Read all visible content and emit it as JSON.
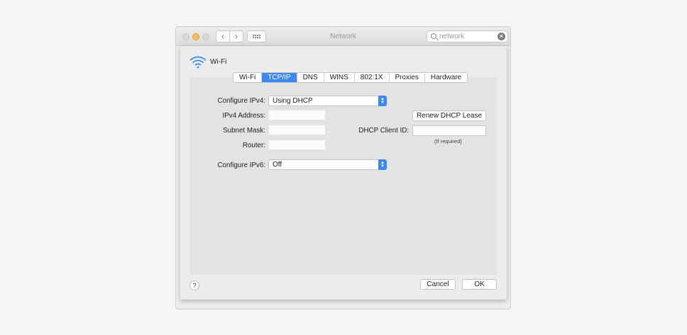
{
  "window": {
    "title": "Network"
  },
  "search": {
    "placeholder": "network"
  },
  "interface": {
    "name": "Wi-Fi"
  },
  "tabs": [
    "Wi-Fi",
    "TCP/IP",
    "DNS",
    "WINS",
    "802.1X",
    "Proxies",
    "Hardware"
  ],
  "active_tab": "TCP/IP",
  "form": {
    "configure_ipv4_label": "Configure IPv4:",
    "configure_ipv4_value": "Using DHCP",
    "ipv4_address_label": "IPv4 Address:",
    "subnet_mask_label": "Subnet Mask:",
    "router_label": "Router:",
    "configure_ipv6_label": "Configure IPv6:",
    "configure_ipv6_value": "Off",
    "renew_button": "Renew DHCP Lease",
    "dhcp_client_id_label": "DHCP Client ID:",
    "if_required": "(If required)"
  },
  "footer": {
    "help": "?",
    "cancel": "Cancel",
    "ok": "OK"
  },
  "colors": {
    "accent": "#3b88f5",
    "minimize": "#f5be4f"
  }
}
